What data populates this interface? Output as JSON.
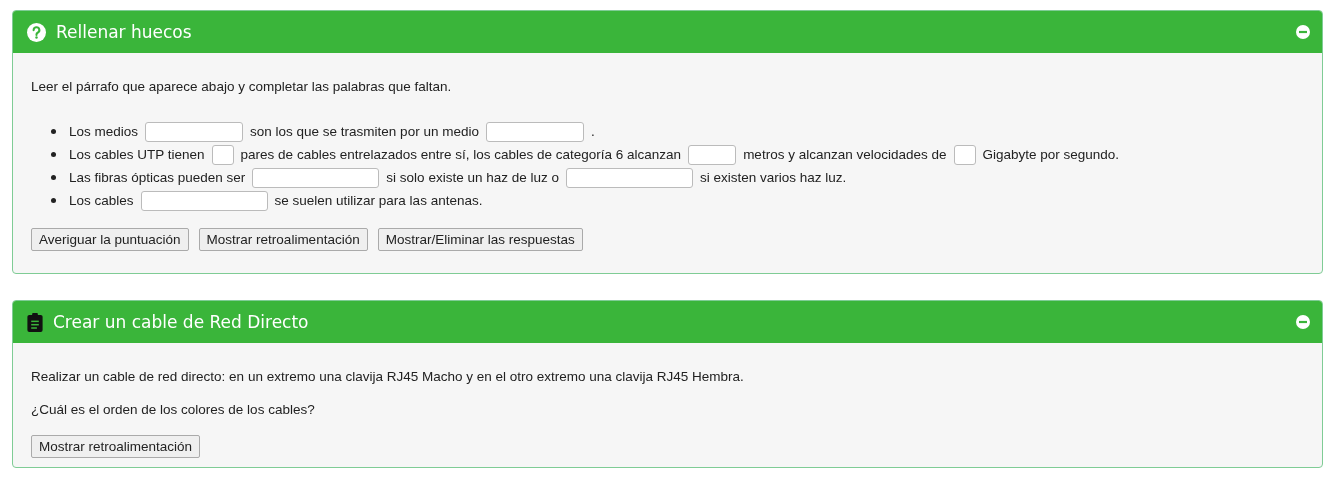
{
  "panels": [
    {
      "kind": "cloze",
      "title": "Rellenar huecos",
      "intro": "Leer el párrafo que aparece abajo y completar las palabras que faltan.",
      "items": [
        [
          {
            "kind": "text",
            "text": "Los medios"
          },
          {
            "kind": "blank"
          },
          {
            "kind": "text",
            "text": "son los que se trasmiten por un medio"
          },
          {
            "kind": "blank"
          },
          {
            "kind": "text",
            "text": "."
          }
        ],
        [
          {
            "kind": "text",
            "text": "Los cables UTP tienen"
          },
          {
            "kind": "tinyblank"
          },
          {
            "kind": "text",
            "text": "pares de cables entrelazados entre sí, los cables de categoría 6 alcanzan"
          },
          {
            "kind": "smallblank"
          },
          {
            "kind": "text",
            "text": "metros y alcanzan velocidades de"
          },
          {
            "kind": "tinyblank"
          },
          {
            "kind": "text",
            "text": "Gigabyte por segundo."
          }
        ],
        [
          {
            "kind": "text",
            "text": "Las fibras ópticas pueden ser"
          },
          {
            "kind": "wideblank"
          },
          {
            "kind": "text",
            "text": "si solo existe un haz de luz o"
          },
          {
            "kind": "wideblank"
          },
          {
            "kind": "text",
            "text": "si existen varios haz luz."
          }
        ],
        [
          {
            "kind": "text",
            "text": "Los cables"
          },
          {
            "kind": "wideblank"
          },
          {
            "kind": "text",
            "text": "se suelen utilizar para las antenas."
          }
        ]
      ],
      "buttons": [
        "Averiguar la puntuación",
        "Mostrar retroalimentación",
        "Mostrar/Eliminar las respuestas"
      ]
    },
    {
      "kind": "task",
      "title": "Crear un cable de Red Directo",
      "paragraphs": [
        "Realizar un cable de red directo: en un extremo una clavija RJ45 Macho y en el otro extremo una clavija RJ45 Hembra.",
        "¿Cuál es el orden de los colores de los cables?"
      ],
      "buttons": [
        "Mostrar retroalimentación"
      ]
    }
  ]
}
